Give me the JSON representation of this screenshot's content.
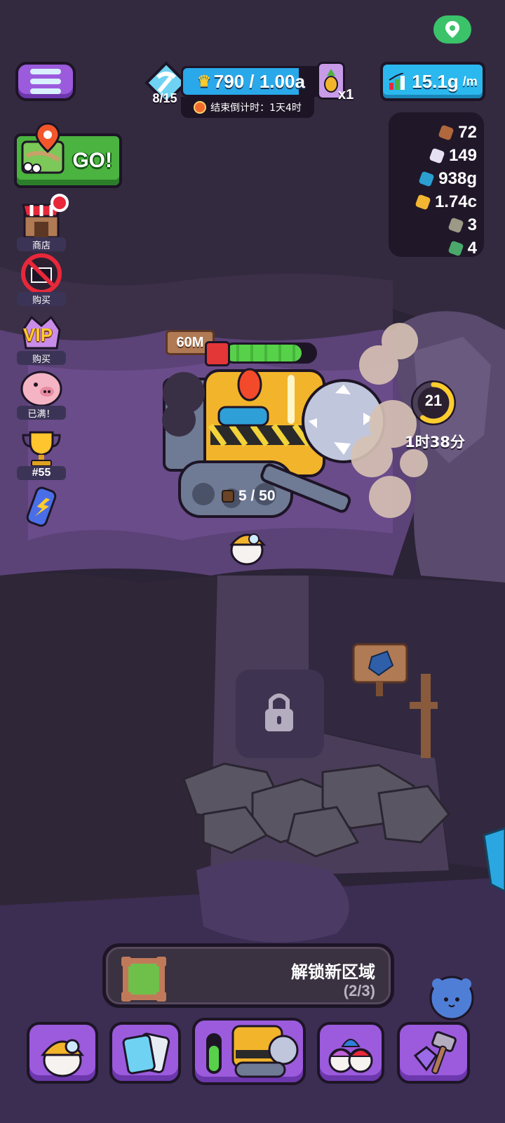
{
  "top_bar": {
    "menu_icon": "hamburger-menu-icon",
    "location_icon": "location-pin-icon",
    "pickaxe_count": "8/15",
    "level_value": "790 / 1.00a",
    "level_progress_fraction": 0.85,
    "countdown": "结束倒计时：1天4时",
    "seed_multiplier": "x1",
    "production_rate": "15.1g",
    "production_unit": "/m"
  },
  "resources": [
    {
      "value": "72",
      "icon": "copper-ore-icon",
      "color": "#b0683c"
    },
    {
      "value": "149",
      "icon": "silver-ore-icon",
      "color": "#e6e1f2"
    },
    {
      "value": "938g",
      "icon": "blue-gem-icon",
      "color": "#2a9fd0"
    },
    {
      "value": "1.74c",
      "icon": "gold-nugget-icon",
      "color": "#f2b632"
    },
    {
      "value": "3",
      "icon": "stone-block-icon",
      "color": "#9b9a86"
    },
    {
      "value": "4",
      "icon": "green-ore-icon",
      "color": "#4aa86b"
    }
  ],
  "side_menu": {
    "go_label": "GO!",
    "shop_label": "商店",
    "no_ads_label": "购买",
    "vip_label": "购买",
    "vip_badge": "VIP",
    "piggy_label": "已满！",
    "rank_label": "#55"
  },
  "machine": {
    "depth": "60M",
    "fuel_fraction": 0.85,
    "cargo": "5 / 50"
  },
  "timer": {
    "count": "21",
    "ring_fraction": 0.6,
    "remaining": "1时38分"
  },
  "unlock": {
    "title": "解锁新区域",
    "progress": "(2/3)"
  },
  "colors": {
    "accent_purple": "#9b5bdc",
    "accent_blue": "#2bb8ee",
    "outline": "#1d1526",
    "go_green": "#4bb33f"
  }
}
